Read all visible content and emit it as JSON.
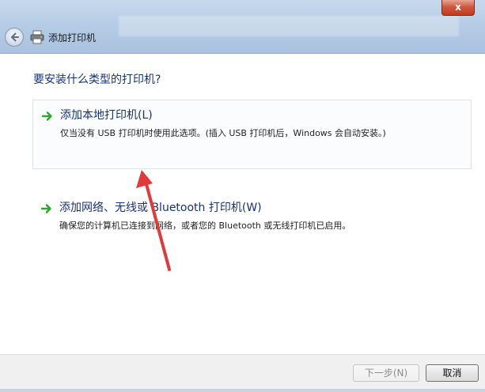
{
  "window": {
    "title": "添加打印机",
    "close_label": "x"
  },
  "page": {
    "question": "要安装什么类型的打印机?"
  },
  "options": [
    {
      "title": "添加本地打印机(L)",
      "description": "仅当没有 USB 打印机时使用此选项。(插入 USB 打印机后，Windows 会自动安装。)"
    },
    {
      "title": "添加网络、无线或 Bluetooth 打印机(W)",
      "description": "确保您的计算机已连接到网络，或者您的 Bluetooth 或无线打印机已启用。"
    }
  ],
  "footer": {
    "next_label": "下一步(N)",
    "cancel_label": "取消"
  },
  "colors": {
    "heading": "#14337f",
    "arrow_green": "#2aa92a",
    "annotation_red": "#e23a3a"
  }
}
